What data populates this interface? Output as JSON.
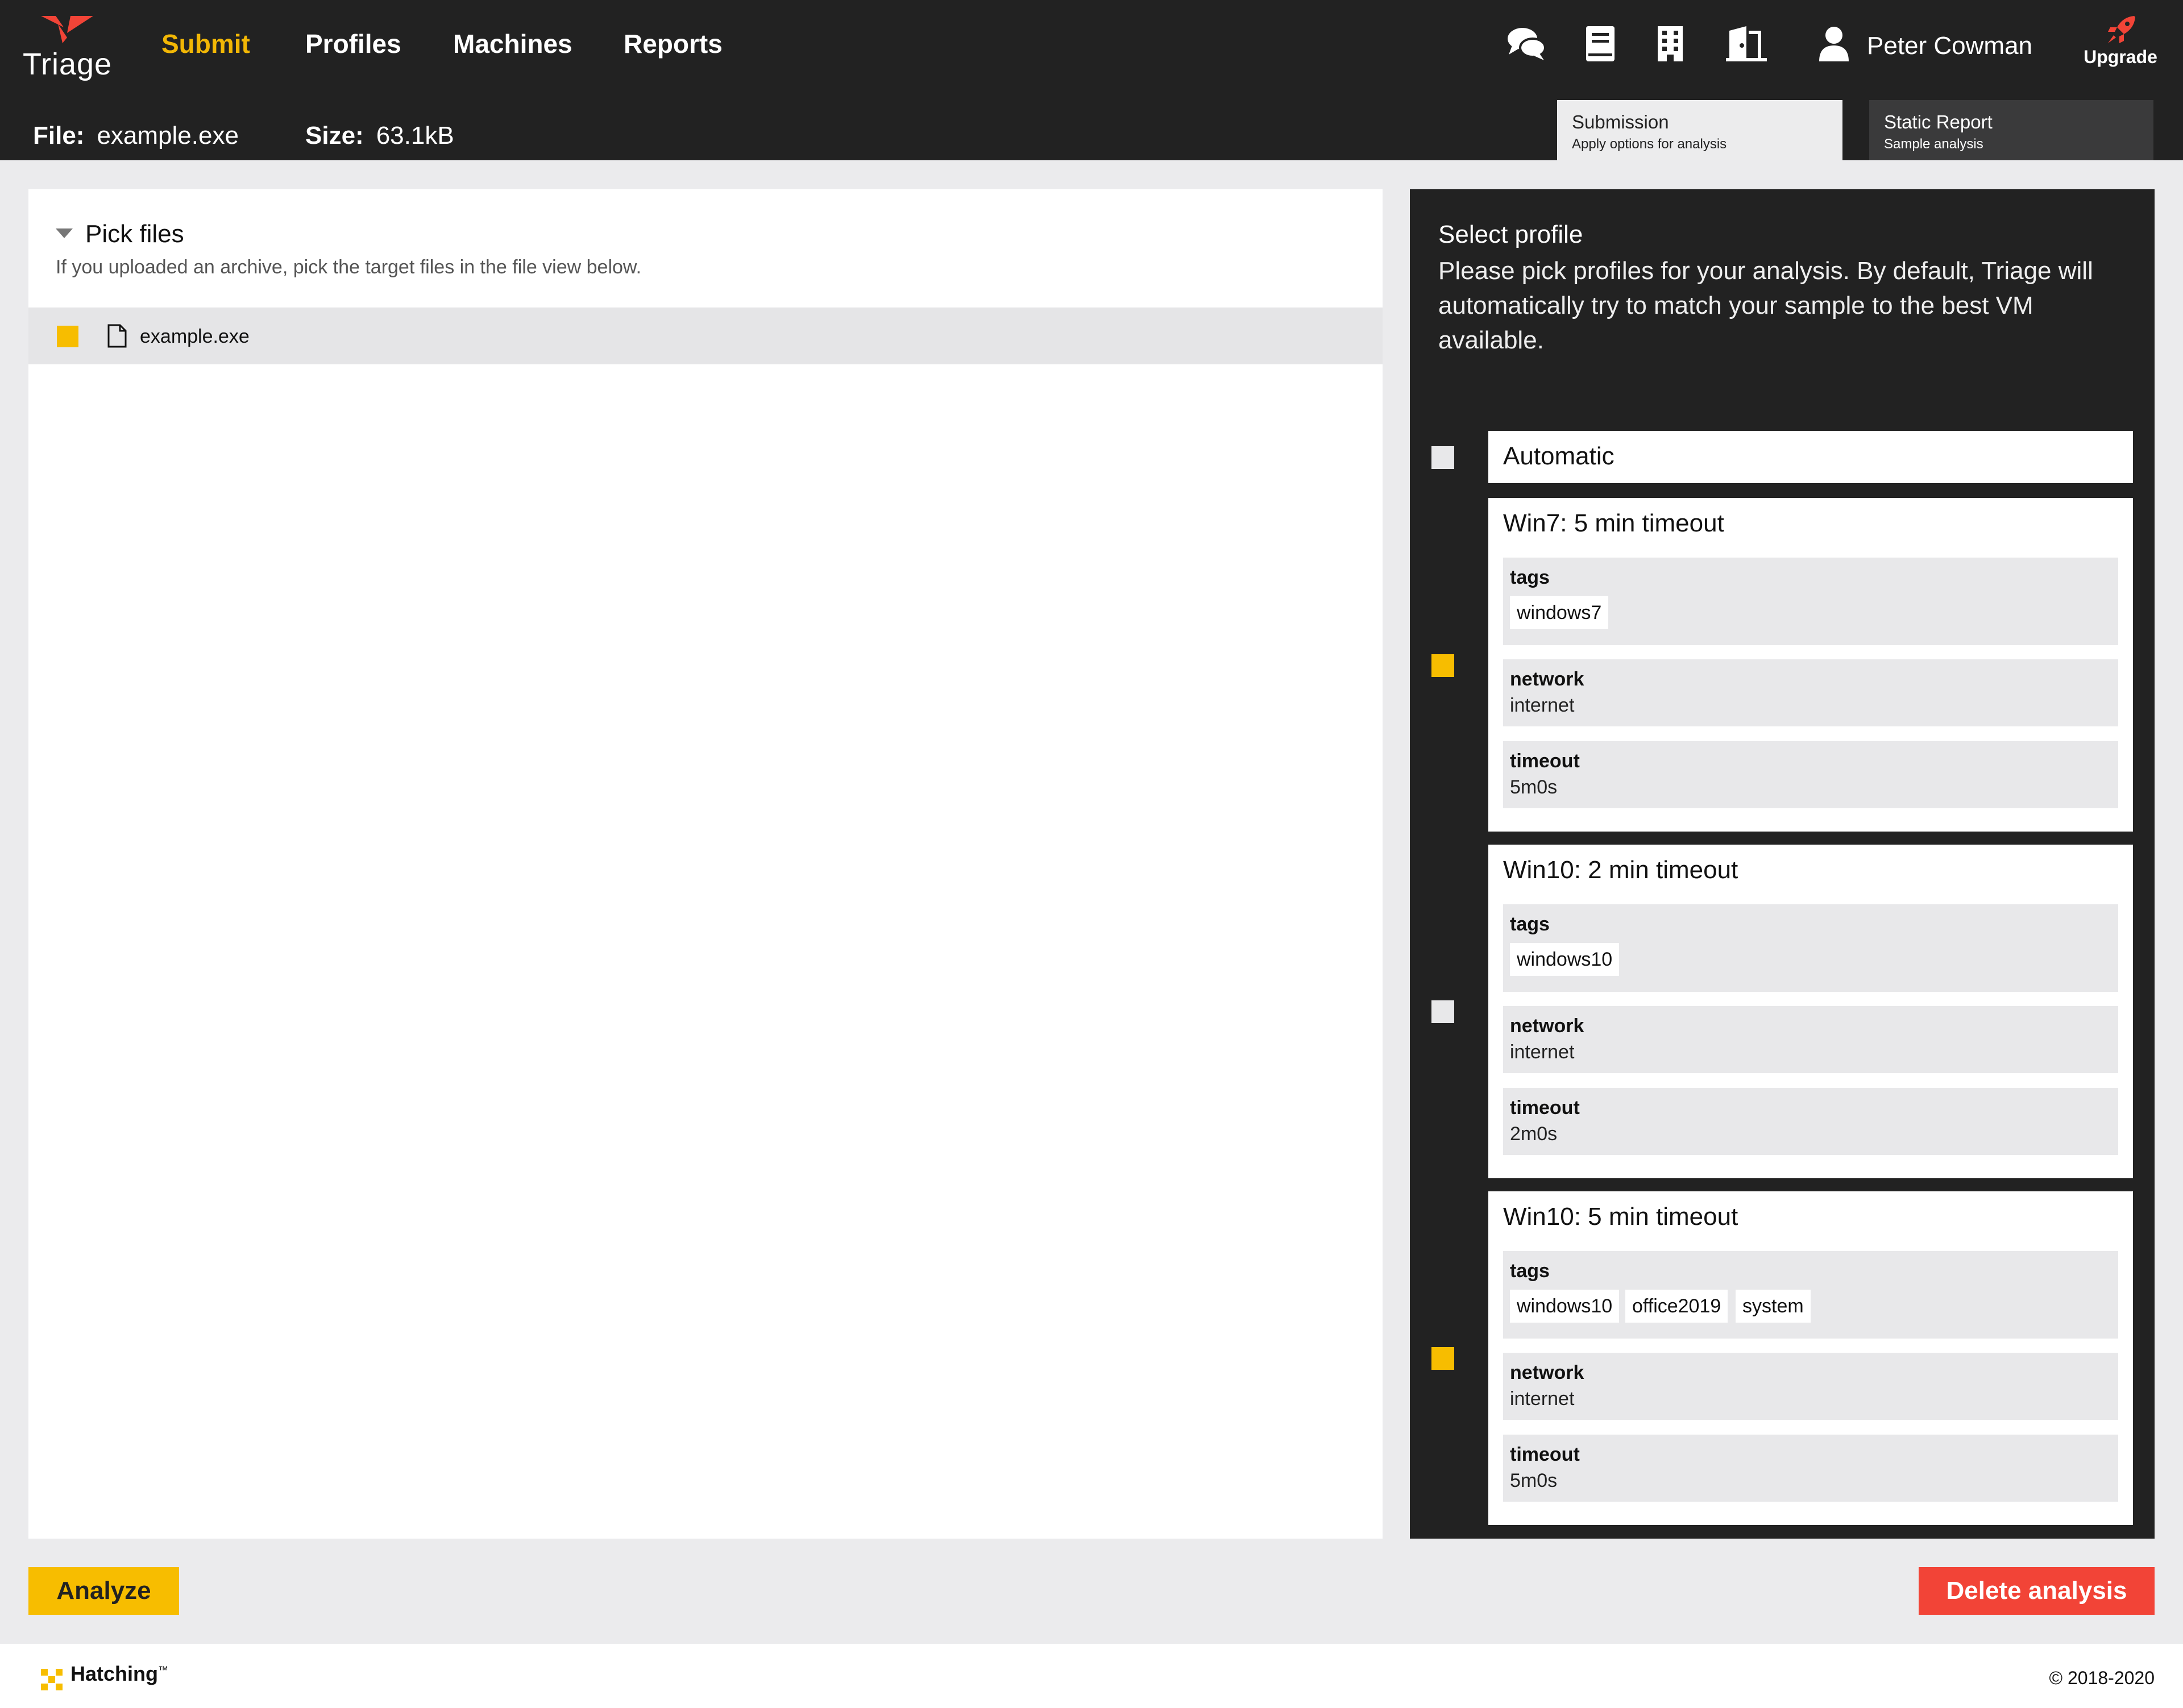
{
  "app": {
    "logo_text": "Triage",
    "accent_color": "#f7bd00",
    "danger_color": "#f24437"
  },
  "nav": {
    "items": [
      {
        "label": "Submit",
        "active": true
      },
      {
        "label": "Profiles",
        "active": false
      },
      {
        "label": "Machines",
        "active": false
      },
      {
        "label": "Reports",
        "active": false
      }
    ],
    "icons": [
      "chat-icon",
      "book-icon",
      "building-icon",
      "logout-door-icon"
    ],
    "user_name": "Peter Cowman",
    "upgrade_label": "Upgrade"
  },
  "file": {
    "file_label": "File:",
    "file_name": "example.exe",
    "size_label": "Size:",
    "size_value": "63.1kB"
  },
  "subtabs": [
    {
      "title": "Submission",
      "subtitle": "Apply options for analysis",
      "active": true
    },
    {
      "title": "Static Report",
      "subtitle": "Sample analysis",
      "active": false
    }
  ],
  "pick_files": {
    "title": "Pick files",
    "description": "If you uploaded an archive, pick the target files in the file view below.",
    "files": [
      {
        "name": "example.exe",
        "checked": true
      }
    ]
  },
  "profiles": {
    "title": "Select profile",
    "description": "Please pick profiles for your analysis. By default, Triage will automatically try to match your sample to the best VM available.",
    "automatic_label": "Automatic",
    "automatic_checked": false,
    "field_labels": {
      "tags": "tags",
      "network": "network",
      "timeout": "timeout"
    },
    "items": [
      {
        "name": "Win7: 5 min timeout",
        "checked": true,
        "tags": [
          "windows7"
        ],
        "network": "internet",
        "timeout": "5m0s"
      },
      {
        "name": "Win10: 2 min timeout",
        "checked": false,
        "tags": [
          "windows10"
        ],
        "network": "internet",
        "timeout": "2m0s"
      },
      {
        "name": "Win10: 5 min timeout",
        "checked": true,
        "tags": [
          "windows10",
          "office2019",
          "system"
        ],
        "network": "internet",
        "timeout": "5m0s"
      }
    ]
  },
  "actions": {
    "analyze_label": "Analyze",
    "delete_label": "Delete analysis"
  },
  "footer": {
    "brand": "Hatching",
    "trademark": "™",
    "copyright": "© 2018-2020"
  }
}
